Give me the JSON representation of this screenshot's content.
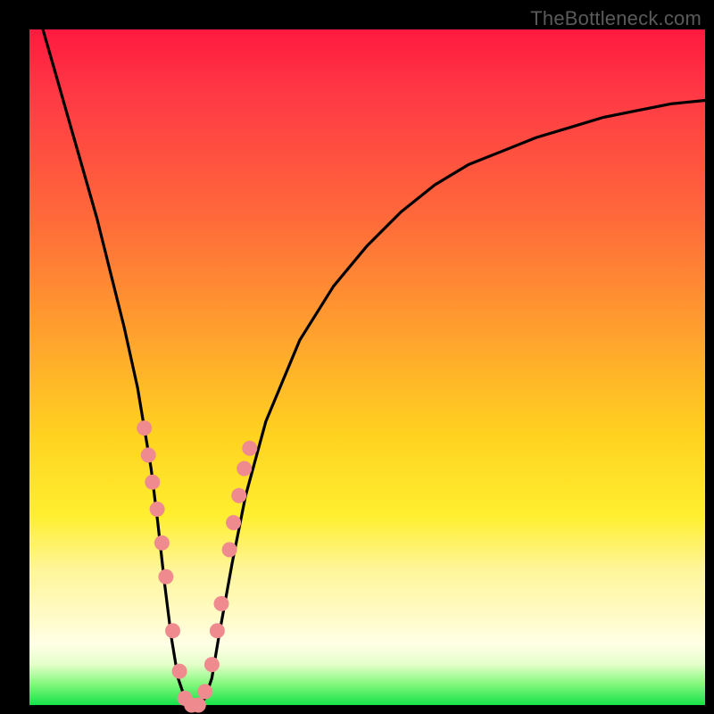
{
  "watermark": "TheBottleneck.com",
  "colors": {
    "background": "#000000",
    "gradient_top": "#ff1a3f",
    "gradient_mid1": "#ff6a3a",
    "gradient_mid2": "#ffd220",
    "gradient_mid3": "#fffbc8",
    "gradient_bottom": "#16e24a",
    "curve": "#000000",
    "marker": "#ef8b8f"
  },
  "chart_data": {
    "type": "line",
    "title": "",
    "xlabel": "",
    "ylabel": "",
    "xlim": [
      0,
      100
    ],
    "ylim": [
      0,
      100
    ],
    "series": [
      {
        "name": "bottleneck-curve",
        "x": [
          2,
          4,
          6,
          8,
          10,
          12,
          14,
          16,
          18,
          19,
          20,
          21,
          22,
          23,
          24,
          25,
          26,
          27,
          28,
          30,
          32,
          35,
          40,
          45,
          50,
          55,
          60,
          65,
          70,
          75,
          80,
          85,
          90,
          95,
          100
        ],
        "y": [
          100,
          93,
          86,
          79,
          72,
          64,
          56,
          47,
          35,
          27,
          18,
          10,
          4,
          1,
          0,
          0,
          1,
          4,
          10,
          21,
          31,
          42,
          54,
          62,
          68,
          73,
          77,
          80,
          82,
          84,
          85.5,
          87,
          88,
          89,
          89.5
        ]
      }
    ],
    "markers": {
      "name": "highlighted-points",
      "x": [
        17,
        17.6,
        18.2,
        18.9,
        19.6,
        20.2,
        21.2,
        22.2,
        23,
        24,
        25,
        26,
        27,
        27.8,
        28.4,
        29.6,
        30.2,
        31,
        31.8,
        32.6
      ],
      "y": [
        41,
        37,
        33,
        29,
        24,
        19,
        11,
        5,
        1,
        0,
        0,
        2,
        6,
        11,
        15,
        23,
        27,
        31,
        35,
        38
      ]
    }
  }
}
